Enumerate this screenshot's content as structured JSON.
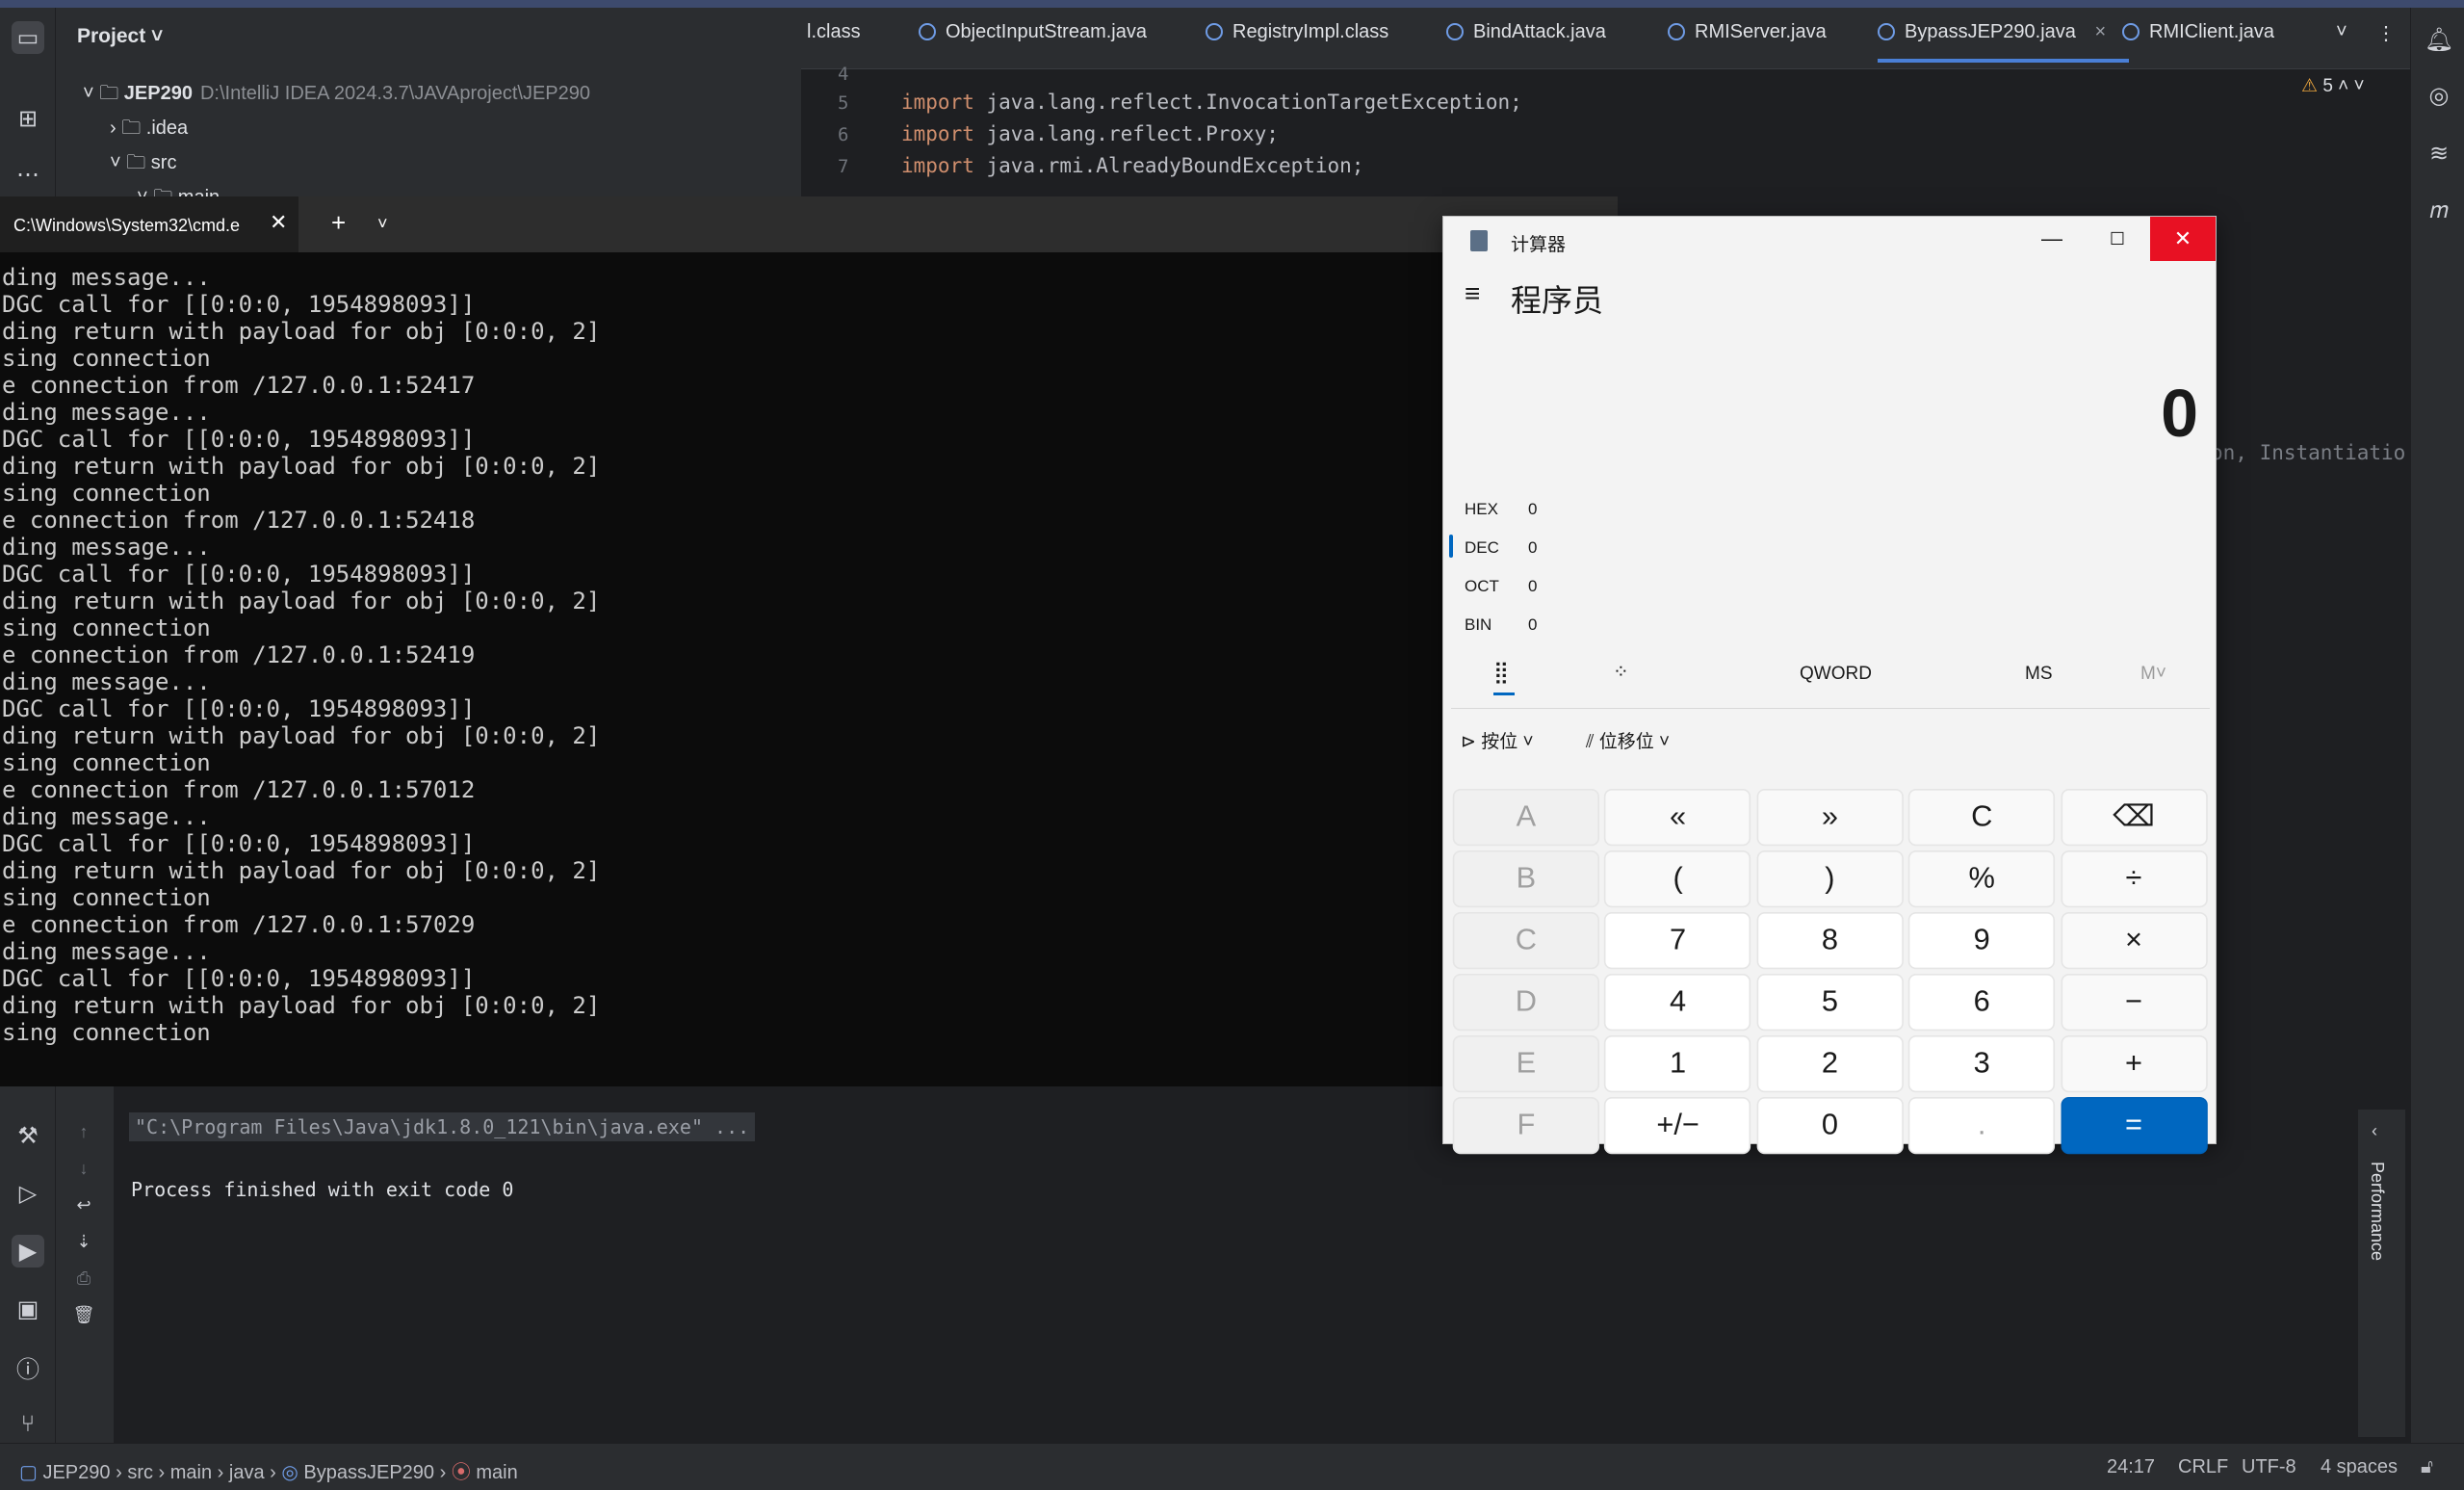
{
  "project": {
    "title": "Project",
    "root_name": "JEP290",
    "root_path": "D:\\IntelliJ IDEA 2024.3.7\\JAVAproject\\JEP290",
    "items": [
      ".idea",
      "src",
      "main"
    ]
  },
  "editor": {
    "tabs": [
      {
        "label": "l.class"
      },
      {
        "label": "ObjectInputStream.java"
      },
      {
        "label": "RegistryImpl.class"
      },
      {
        "label": "BindAttack.java"
      },
      {
        "label": "RMIServer.java"
      },
      {
        "label": "BypassJEP290.java"
      },
      {
        "label": "RMIClient.java"
      }
    ],
    "warning_count": "5",
    "line_numbers": [
      "4",
      "5",
      "6",
      "7"
    ],
    "lines": [
      {
        "kw": "import",
        "pkg": "java.lang.reflect.InvocationTargetException;"
      },
      {
        "kw": "import",
        "pkg": "java.lang.reflect.Proxy;"
      },
      {
        "kw": "import",
        "pkg": "java.rmi.AlreadyBoundException;"
      }
    ],
    "partial_text": "on, Instantiatio"
  },
  "cmd": {
    "tab_title": "C:\\Windows\\System32\\cmd.e",
    "lines": [
      "ding message...",
      "DGC call for [[0:0:0, 1954898093]]",
      "ding return with payload for obj [0:0:0, 2]",
      "sing connection",
      "e connection from /127.0.0.1:52417",
      "ding message...",
      "DGC call for [[0:0:0, 1954898093]]",
      "ding return with payload for obj [0:0:0, 2]",
      "sing connection",
      "e connection from /127.0.0.1:52418",
      "ding message...",
      "DGC call for [[0:0:0, 1954898093]]",
      "ding return with payload for obj [0:0:0, 2]",
      "sing connection",
      "e connection from /127.0.0.1:52419",
      "ding message...",
      "DGC call for [[0:0:0, 1954898093]]",
      "ding return with payload for obj [0:0:0, 2]",
      "sing connection",
      "e connection from /127.0.0.1:57012",
      "ding message...",
      "DGC call for [[0:0:0, 1954898093]]",
      "ding return with payload for obj [0:0:0, 2]",
      "sing connection",
      "e connection from /127.0.0.1:57029",
      "ding message...",
      "DGC call for [[0:0:0, 1954898093]]",
      "ding return with payload for obj [0:0:0, 2]",
      "sing connection"
    ]
  },
  "run": {
    "command": "\"C:\\Program Files\\Java\\jdk1.8.0_121\\bin\\java.exe\" ...",
    "exit": "Process finished with exit code 0",
    "side_label": "Performance"
  },
  "calculator": {
    "window_title": "计算器",
    "mode": "程序员",
    "display": "0",
    "radix": [
      {
        "name": "HEX",
        "value": "0"
      },
      {
        "name": "DEC",
        "value": "0"
      },
      {
        "name": "OCT",
        "value": "0"
      },
      {
        "name": "BIN",
        "value": "0"
      }
    ],
    "word_size": "QWORD",
    "ms": "MS",
    "mv": "M˅",
    "bitwise": "按位",
    "bitshift": "位移位",
    "keys": [
      [
        "A",
        "«",
        "»",
        "C",
        "⌫"
      ],
      [
        "B",
        "(",
        ")",
        "%",
        "÷"
      ],
      [
        "C",
        "7",
        "8",
        "9",
        "×"
      ],
      [
        "D",
        "4",
        "5",
        "6",
        "−"
      ],
      [
        "E",
        "1",
        "2",
        "3",
        "+"
      ],
      [
        "F",
        "+/−",
        "0",
        ".",
        "="
      ]
    ]
  },
  "statusbar": {
    "breadcrumbs": [
      "JEP290",
      "src",
      "main",
      "java",
      "BypassJEP290",
      "main"
    ],
    "position": "24:17",
    "line_ending": "CRLF",
    "encoding": "UTF-8",
    "indent": "4 spaces"
  }
}
